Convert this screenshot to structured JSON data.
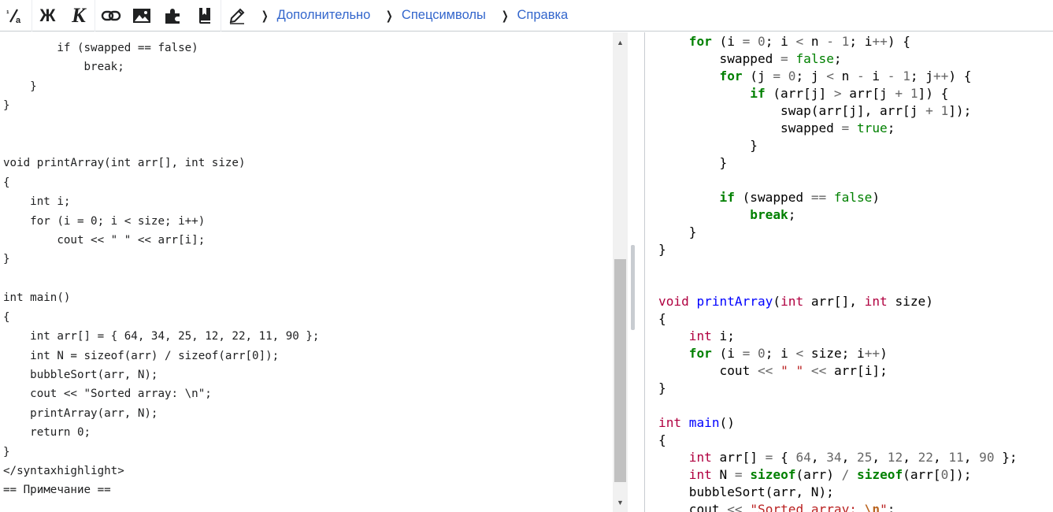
{
  "toolbar": {
    "buttons": [
      {
        "name": "format-icon",
        "glyph": "¹⁄ₐ"
      },
      {
        "name": "bold-button",
        "label": "Ж"
      },
      {
        "name": "italic-button",
        "label": "К"
      },
      {
        "name": "link-icon"
      },
      {
        "name": "image-icon"
      },
      {
        "name": "puzzle-icon"
      },
      {
        "name": "book-icon"
      },
      {
        "name": "pencil-icon"
      }
    ],
    "groups": [
      {
        "label": "Дополнительно"
      },
      {
        "label": "Спецсимволы"
      },
      {
        "label": "Справка"
      }
    ],
    "link_color": "#3366cc"
  },
  "editor": {
    "lines": [
      "        if (swapped == false)",
      "            break;",
      "    }",
      "}",
      "",
      "",
      "void printArray(int arr[], int size)",
      "{",
      "    int i;",
      "    for (i = 0; i < size; i++)",
      "        cout << \" \" << arr[i];",
      "}",
      "",
      "int main()",
      "{",
      "    int arr[] = { 64, 34, 25, 12, 22, 11, 90 };",
      "    int N = sizeof(arr) / sizeof(arr[0]);",
      "    bubbleSort(arr, N);",
      "    cout << \"Sorted array: \\n\";",
      "    printArray(arr, N);",
      "    return 0;",
      "}",
      "</syntaxhighlight>",
      "== Примечание =="
    ]
  },
  "preview": {
    "code": "    for (i = 0; i < n - 1; i++) {\n        swapped = false;\n        for (j = 0; j < n - i - 1; j++) {\n            if (arr[j] > arr[j + 1]) {\n                swap(arr[j], arr[j + 1]);\n                swapped = true;\n            }\n        }\n\n        if (swapped == false)\n            break;\n    }\n}\n\n\nvoid printArray(int arr[], int size)\n{\n    int i;\n    for (i = 0; i < size; i++)\n        cout << \" \" << arr[i];\n}\n\nint main()\n{\n    int arr[] = { 64, 34, 25, 12, 22, 11, 90 };\n    int N = sizeof(arr) / sizeof(arr[0]);\n    bubbleSort(arr, N);\n    cout << \"Sorted array: \\n\";",
    "colors": {
      "keyword": "#008000",
      "type": "#b00040",
      "function": "#0000ff",
      "number": "#666666",
      "string": "#ba2121",
      "escape": "#bb6622"
    }
  }
}
